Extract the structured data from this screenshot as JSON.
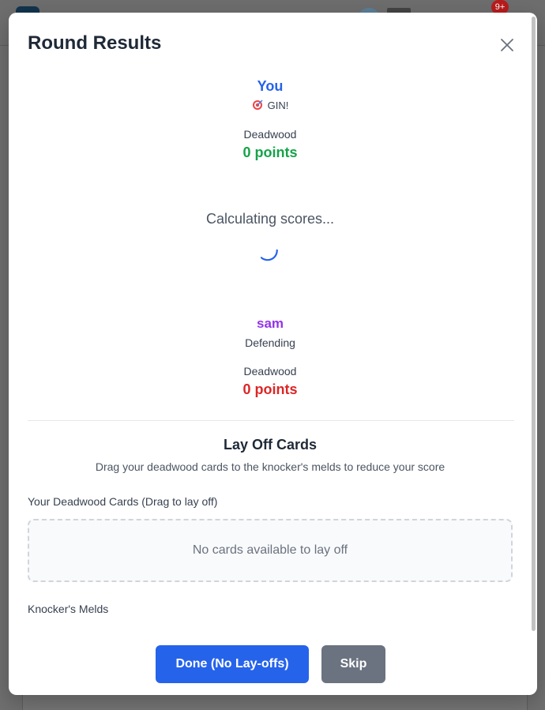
{
  "background": {
    "badge_count": "9+"
  },
  "modal": {
    "title": "Round Results"
  },
  "player_you": {
    "name": "You",
    "status_icon": "target-icon",
    "status": "GIN!",
    "deadwood_label": "Deadwood",
    "points": "0 points",
    "name_color": "#2563eb",
    "points_color": "#16a34a"
  },
  "calculating": {
    "text": "Calculating scores..."
  },
  "player_opponent": {
    "name": "sam",
    "status": "Defending",
    "deadwood_label": "Deadwood",
    "points": "0 points",
    "name_color": "#9333ea",
    "points_color": "#dc2626"
  },
  "layoff": {
    "title": "Lay Off Cards",
    "description": "Drag your deadwood cards to the knocker's melds to reduce your score",
    "deadwood_section_label": "Your Deadwood Cards (Drag to lay off)",
    "empty_message": "No cards available to lay off",
    "melds_section_label": "Knocker's Melds"
  },
  "actions": {
    "done_label": "Done (No Lay-offs)",
    "skip_label": "Skip",
    "done_color": "#2563eb",
    "skip_color": "#6b7280"
  }
}
